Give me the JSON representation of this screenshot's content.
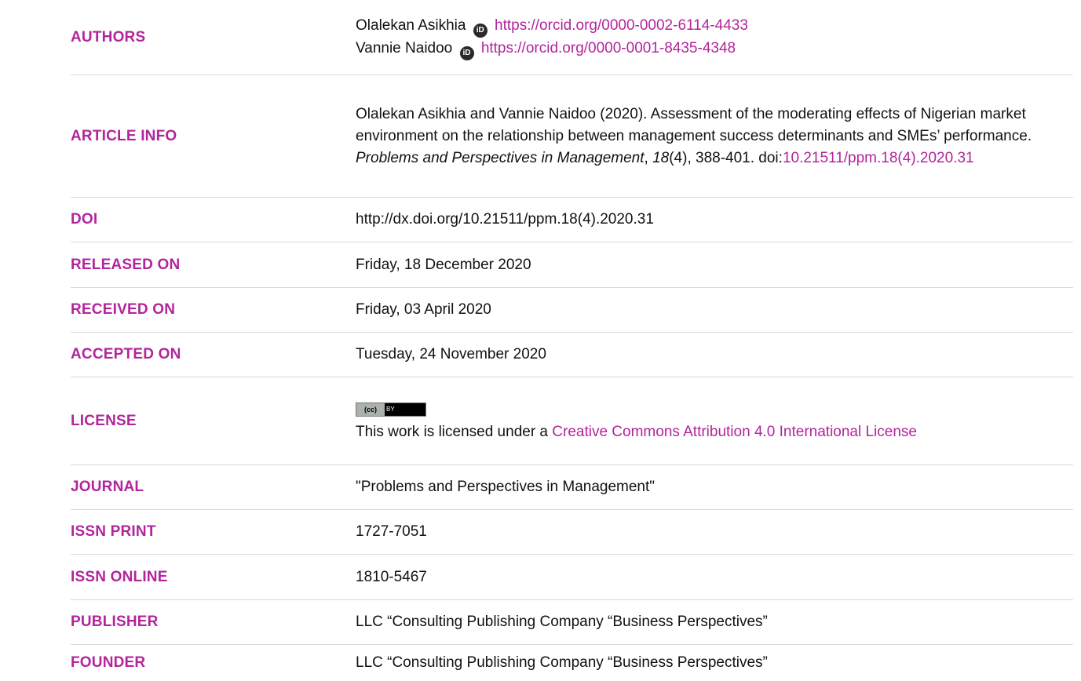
{
  "rows": {
    "authors": {
      "label": "AUTHORS",
      "authors": [
        {
          "name": "Olalekan Asikhia",
          "orcid_url": "https://orcid.org/0000-0002-6114-4433"
        },
        {
          "name": "Vannie Naidoo",
          "orcid_url": "https://orcid.org/0000-0001-8435-4348"
        }
      ]
    },
    "article_info": {
      "label": "ARTICLE INFO",
      "citation_prefix": "Olalekan Asikhia and Vannie Naidoo (2020). Assessment of the moderating effects of Nigerian market environment on the relationship between management success determinants and SMEs’ performance. ",
      "journal_italic": "Problems and Perspectives in Management",
      "sep1": ", ",
      "volume_italic": "18",
      "issue_pages": "(4), 388-401. doi:",
      "doi_link": "10.21511/ppm.18(4).2020.31"
    },
    "doi": {
      "label": "DOI",
      "value": "http://dx.doi.org/10.21511/ppm.18(4).2020.31"
    },
    "released_on": {
      "label": "RELEASED ON",
      "value": "Friday, 18 December 2020"
    },
    "received_on": {
      "label": "RECEIVED ON",
      "value": "Friday, 03 April 2020"
    },
    "accepted_on": {
      "label": "ACCEPTED ON",
      "value": "Tuesday, 24 November 2020"
    },
    "license": {
      "label": "LICENSE",
      "badge_left": "(cc)",
      "badge_right": "BY",
      "text_prefix": "This work is licensed under a ",
      "link_text": "Creative Commons Attribution 4.0 International License"
    },
    "journal": {
      "label": "JOURNAL",
      "value": "\"Problems and Perspectives in Management\""
    },
    "issn_print": {
      "label": "ISSN PRINT",
      "value": "1727-7051"
    },
    "issn_online": {
      "label": "ISSN ONLINE",
      "value": "1810-5467"
    },
    "publisher": {
      "label": "PUBLISHER",
      "value": "LLC “Consulting Publishing Company “Business Perspectives”"
    },
    "founder": {
      "label": "FOUNDER",
      "value": "LLC “Consulting Publishing Company “Business Perspectives”"
    }
  },
  "icons": {
    "orcid": "orcid-id-icon",
    "orcid_glyph": "iD"
  },
  "colors": {
    "accent": "#b3249c",
    "text": "#111111",
    "divider": "#d9d9d9"
  }
}
